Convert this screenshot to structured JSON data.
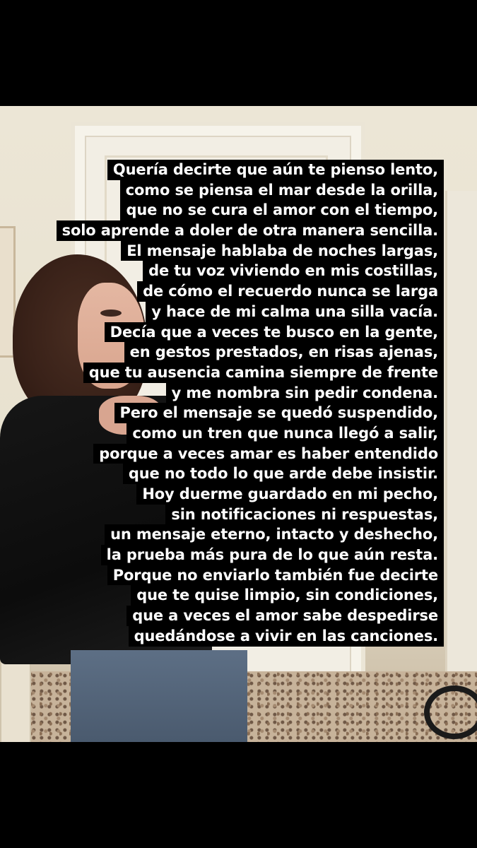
{
  "story": {
    "lines": [
      "Quería decirte que aún te pienso lento,",
      "como se piensa el mar desde la orilla,",
      "que no se cura el amor con el tiempo,",
      "solo aprende a doler de otra manera sencilla.",
      "El mensaje hablaba de noches largas,",
      "de tu voz viviendo en mis costillas,",
      "de cómo el recuerdo nunca se larga",
      "y hace de mi calma una silla vacía.",
      "Decía que a veces te busco en la gente,",
      "en gestos prestados, en risas ajenas,",
      "que tu ausencia camina siempre de frente",
      "y me nombra sin pedir condena.",
      "Pero el mensaje se quedó suspendido,",
      "como un tren que nunca llegó a salir,",
      "porque a veces amar es haber entendido",
      "que no todo lo que arde debe insistir.",
      "Hoy duerme guardado en mi pecho,",
      "sin notificaciones ni respuestas,",
      "un mensaje eterno, intacto y deshecho,",
      "la prueba más pura de lo que aún resta.",
      "Porque no enviarlo también fue decirte",
      "que te quise limpio, sin condiciones,",
      "que a veces el amor sabe despedirse",
      "quedándose a vivir en las canciones."
    ]
  },
  "colors": {
    "background": "#000000",
    "text": "#ffffff",
    "text_highlight": "#000000"
  }
}
